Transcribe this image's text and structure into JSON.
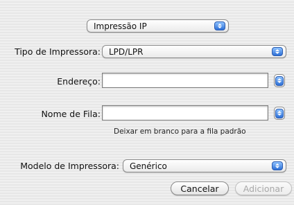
{
  "protocol_menu": {
    "value": "Impressão IP"
  },
  "printer_type": {
    "label": "Tipo de Impressora:",
    "value": "LPD/LPR"
  },
  "address": {
    "label": "Endereço:",
    "value": "",
    "placeholder": ""
  },
  "queue": {
    "label": "Nome de Fila:",
    "value": "",
    "placeholder": "",
    "hint": "Deixar em branco para a fila padrão"
  },
  "printer_model": {
    "label": "Modelo de Impressora:",
    "value": "Genérico"
  },
  "buttons": {
    "cancel": "Cancelar",
    "add": "Adicionar"
  },
  "icons": {
    "popup_arrows": "up-down-arrows-icon"
  },
  "colors": {
    "accent": "#2d6fd6"
  }
}
